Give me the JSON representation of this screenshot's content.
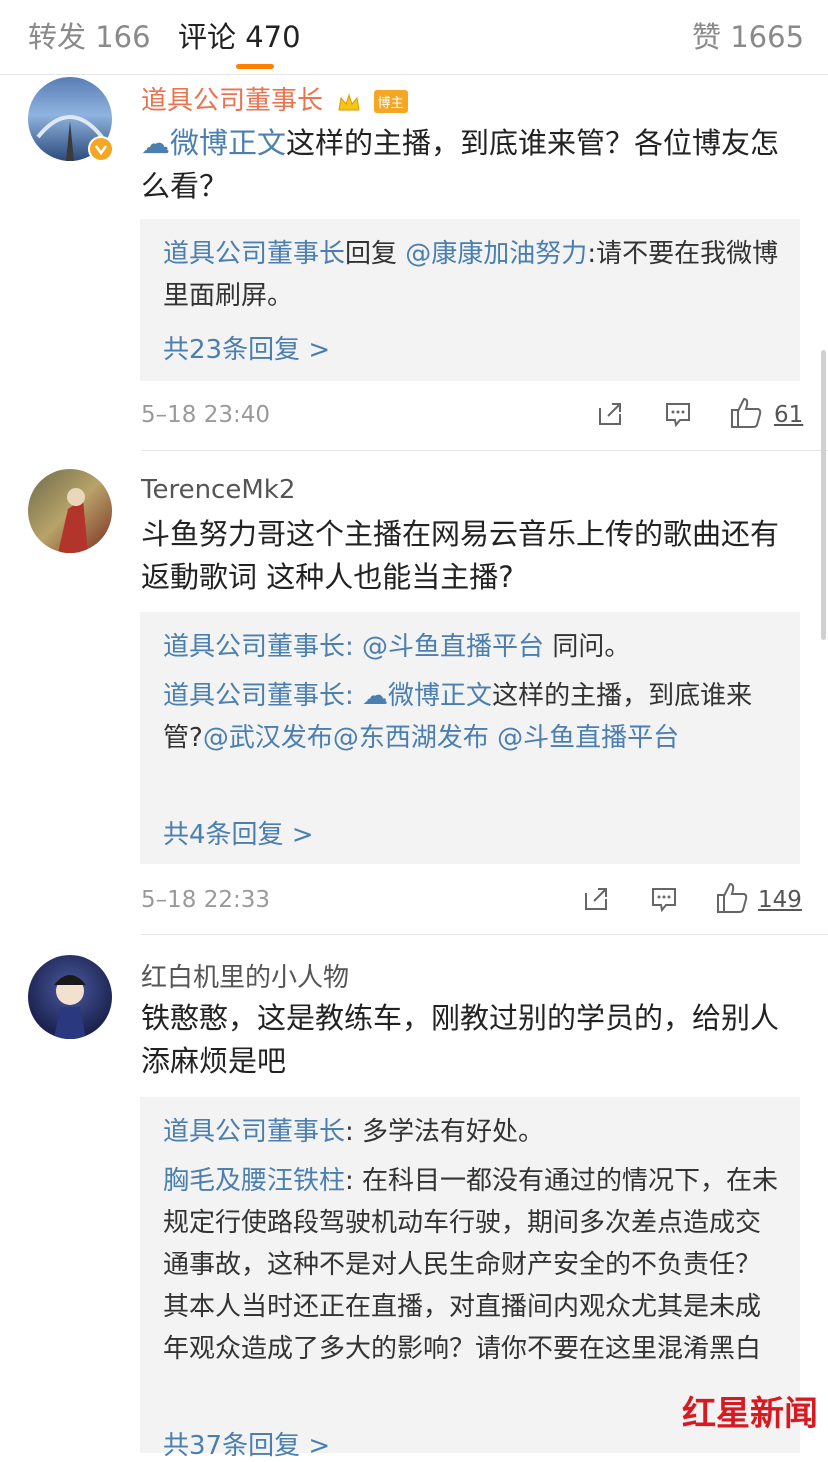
{
  "tabs": {
    "reposts": "转发 166",
    "comments": "评论 470",
    "likes": "赞 1665"
  },
  "comments": [
    {
      "user": "道具公司董事长",
      "badge": "博主",
      "text_link": "微博正文",
      "text": "这样的主播，到底谁来管？各位博友怎么看？",
      "reply_user": "道具公司董事长",
      "reply_mid": "回复",
      "reply_target": "@康康加油努力",
      "reply_text": ":请不要在我微博里面刷屏。",
      "more": "共23条回复 >",
      "time": "5–18 23:40",
      "likes": "61"
    },
    {
      "user": "TerenceMk2",
      "text": "斗鱼努力哥这个主播在网易云音乐上传的歌曲还有返動歌词 这种人也能当主播?",
      "reply1_user": "道具公司董事长",
      "reply1_sep": ":",
      "reply1_link": "@斗鱼直播平台",
      "reply1_text": " 同问。",
      "reply2_user": "道具公司董事长",
      "reply2_sep": ":",
      "reply2_link": "微博正文",
      "reply2_text": "这样的主播，到底谁来管?",
      "reply2_at1": "@武汉发布",
      "reply2_at2": "@东西湖发布",
      "reply2_at3": "@斗鱼直播平台",
      "more": "共4条回复 >",
      "time": "5–18 22:33",
      "likes": "149"
    },
    {
      "user": "红白机里的小人物",
      "text": "铁憨憨，这是教练车，刚教过别的学员的，给别人添麻烦是吧",
      "reply1_user": "道具公司董事长",
      "reply1_text": ": 多学法有好处。",
      "reply2_user": "胸毛及腰汪铁柱",
      "reply2_text": ": 在科目一都没有通过的情况下，在未规定行使路段驾驶机动车行驶，期间多次差点造成交通事故，这种不是对人民生命财产安全的不负责任？其本人当时还正在直播，对直播间内观众尤其是未成年观众造成了多大的影响？请你不要在这里混淆黑白",
      "more": "共37条回复 >"
    }
  ],
  "watermark": "红星新闻"
}
